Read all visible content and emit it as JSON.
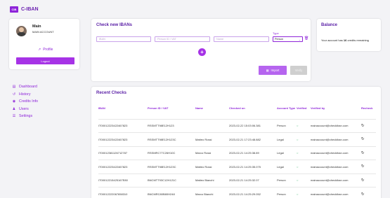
{
  "brand": {
    "logo_mark": "CIB",
    "name": "C-IBAN"
  },
  "account": {
    "name": "Main",
    "type": "MAIN ACCOUNT",
    "profile_label": "Profile",
    "logout_label": "Logout"
  },
  "nav": [
    {
      "label": "Dashboard",
      "icon": "dashboard-icon"
    },
    {
      "label": "History",
      "icon": "history-icon"
    },
    {
      "label": "Credits Info",
      "icon": "credits-icon"
    },
    {
      "label": "Users",
      "icon": "users-icon"
    },
    {
      "label": "Settings",
      "icon": "settings-icon"
    }
  ],
  "check": {
    "title": "Check new IBANs",
    "iban_placeholder": "IBAN",
    "person_placeholder": "Person ID / VAT",
    "name_placeholder": "Name",
    "type_label": "Type",
    "type_value": "Person",
    "import_label": "Import",
    "verify_label": "Verify"
  },
  "balance": {
    "title": "Balance",
    "text_before": "Your account has ",
    "credits": "16",
    "text_after": " credits remaining"
  },
  "recent": {
    "title": "Recent Checks",
    "columns": [
      "IBAN",
      "Person ID / VAT",
      "Name",
      "Checked on",
      "Account Type",
      "Verified",
      "Verified by",
      "Recheck"
    ],
    "rows": [
      [
        "IT00012223422467823",
        "RSSMTT98E12H123",
        "",
        "2023-02-22 15:03:06.381",
        "Person",
        "mainaccount@checkiban.com"
      ],
      [
        "IT00012223422467823",
        "RSSMTT98E12H123C",
        "Matteo Rossi",
        "2023-02-21 17:23:48.882",
        "Legal",
        "mainaccount@checkiban.com"
      ],
      [
        "IT00012381126712787",
        "RSSMRC77C26H10C",
        "Marco Rossi",
        "2023-02-21 14:25:38.89",
        "Legal",
        "mainaccount@checkiban.com"
      ],
      [
        "IT00012223422467823",
        "RSSMTT98E12H123C",
        "Matteo Rossi",
        "2023-02-21 14:25:35.075",
        "Legal",
        "mainaccount@checkiban.com"
      ],
      [
        "IT00012215425167E80",
        "BNCMTT93C12H121C",
        "Matteo Bianchi",
        "2023-02-21 14:25:32.07",
        "Person",
        "mainaccount@checkiban.com"
      ],
      [
        "IT00012222067658310",
        "BNCMRC80B80H248",
        "Marco Bianchi",
        "2023-02-21 14:25:29.052",
        "Person",
        "mainaccount@checkiban.com"
      ]
    ]
  },
  "colors": {
    "accent": "#8e24d9",
    "button": "#a633e6",
    "verified": "#3bb46b"
  }
}
